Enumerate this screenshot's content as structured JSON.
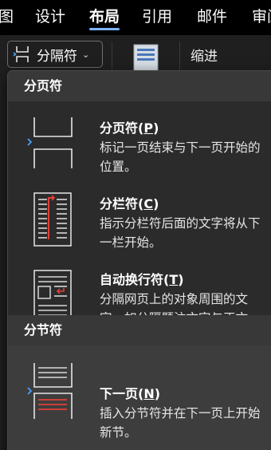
{
  "ribbon": {
    "tabs": [
      {
        "label": "图"
      },
      {
        "label": "设计"
      },
      {
        "label": "布局"
      },
      {
        "label": "引用"
      },
      {
        "label": "邮件"
      },
      {
        "label": "审阅"
      }
    ],
    "active_tab": "布局"
  },
  "toolbar": {
    "breaks_label": "分隔符",
    "breaks_icon": "page-break-icon",
    "indent_label": "缩进"
  },
  "menu": {
    "page_breaks_header": "分页符",
    "section_breaks_header": "分节符",
    "items": [
      {
        "title": "分页符",
        "key": "P",
        "desc_line1": "标记一页结束与下一页开始的",
        "desc_line2": "位置。",
        "icon": "page-break-icon"
      },
      {
        "title": "分栏符",
        "key": "C",
        "desc_line1": "指示分栏符后面的文字将从下",
        "desc_line2": "一栏开始。",
        "icon": "column-break-icon"
      },
      {
        "title": "自动换行符",
        "key": "T",
        "desc_line1": "分隔网页上的对象周围的文",
        "desc_line2": "字，如分隔题注文字与正文。",
        "icon": "text-wrapping-icon"
      },
      {
        "title": "下一页",
        "key": "N",
        "desc_line1": "插入分节符并在下一页上开始",
        "desc_line2": "新节。",
        "icon": "next-page-section-icon"
      }
    ]
  },
  "colors": {
    "accent_blue": "#4aa3ff",
    "accent_red": "#e0403a",
    "tab_underline": "#7eb3ff"
  }
}
